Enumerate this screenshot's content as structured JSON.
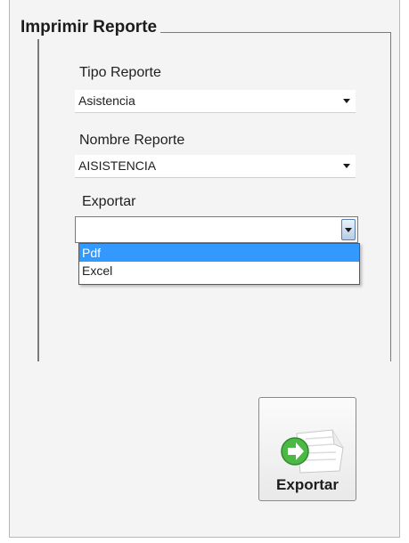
{
  "group": {
    "title": "Imprimir Reporte"
  },
  "tipo_reporte": {
    "label": "Tipo Reporte",
    "value": "Asistencia"
  },
  "nombre_reporte": {
    "label": "Nombre Reporte",
    "value": "AISISTENCIA"
  },
  "exportar": {
    "label": "Exportar",
    "value": "",
    "options": [
      "Pdf",
      "Excel"
    ],
    "selected": "Pdf"
  },
  "export_button": {
    "label": "Exportar",
    "icon": "export-arrow-icon"
  },
  "colors": {
    "selection": "#3399ff",
    "arrow_green": "#4cb846"
  }
}
